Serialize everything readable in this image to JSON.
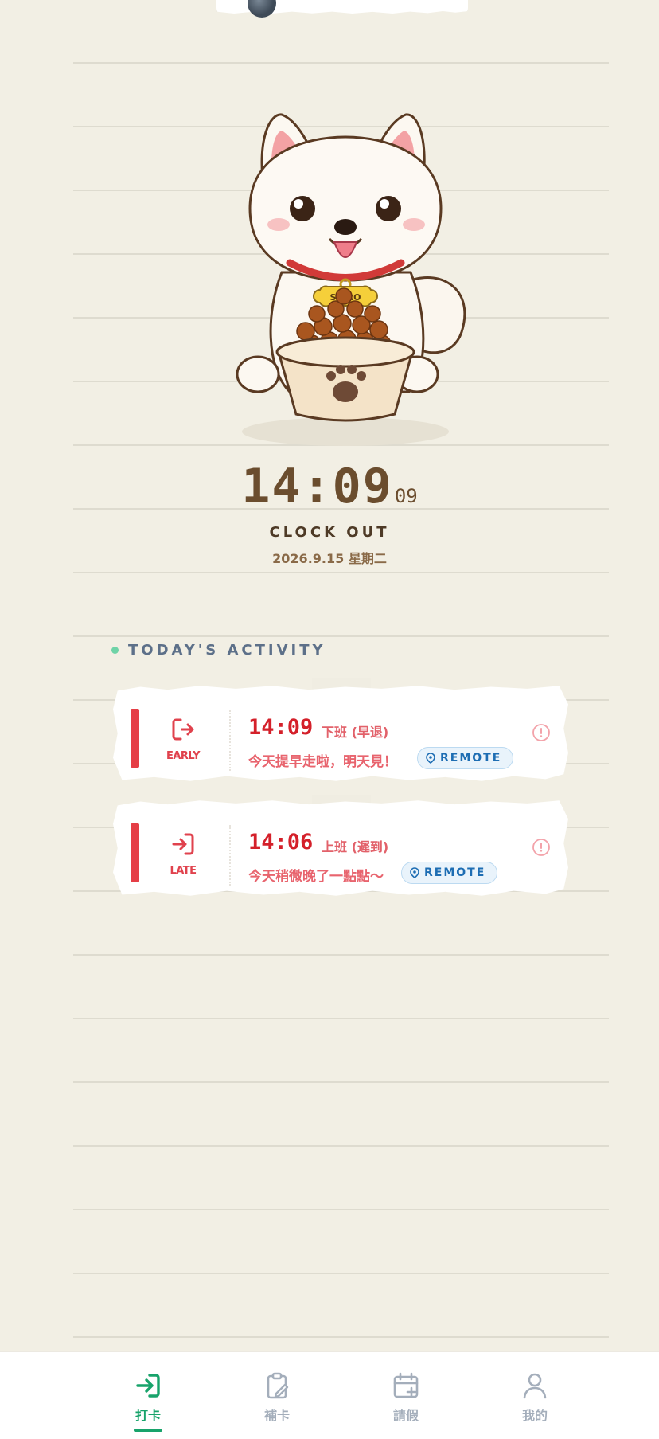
{
  "clock": {
    "hm": "14:09",
    "sec": "09",
    "label": "CLOCK OUT",
    "date": "2026.9.15 星期二"
  },
  "pet": {
    "tag_text": "SHIRO"
  },
  "activity": {
    "title": "TODAY'S ACTIVITY",
    "items": [
      {
        "icon": "logout-arrow-icon",
        "tag": "EARLY",
        "time": "14:09",
        "type": "下班 (早退)",
        "message": "今天提早走啦，明天見！",
        "badge": "REMOTE"
      },
      {
        "icon": "login-arrow-icon",
        "tag": "LATE",
        "time": "14:06",
        "type": "上班 (遲到)",
        "message": "今天稍微晚了一點點～",
        "badge": "REMOTE"
      }
    ]
  },
  "nav": {
    "items": [
      {
        "label": "打卡",
        "icon": "clock-in-icon",
        "active": true
      },
      {
        "label": "補卡",
        "icon": "clipboard-edit-icon",
        "active": false
      },
      {
        "label": "請假",
        "icon": "calendar-plus-icon",
        "active": false
      },
      {
        "label": "我的",
        "icon": "user-icon",
        "active": false
      }
    ]
  },
  "colors": {
    "accent": "#18a36b",
    "alert": "#e53e46",
    "brown": "#6b4d2e",
    "background": "#f2efe4"
  }
}
